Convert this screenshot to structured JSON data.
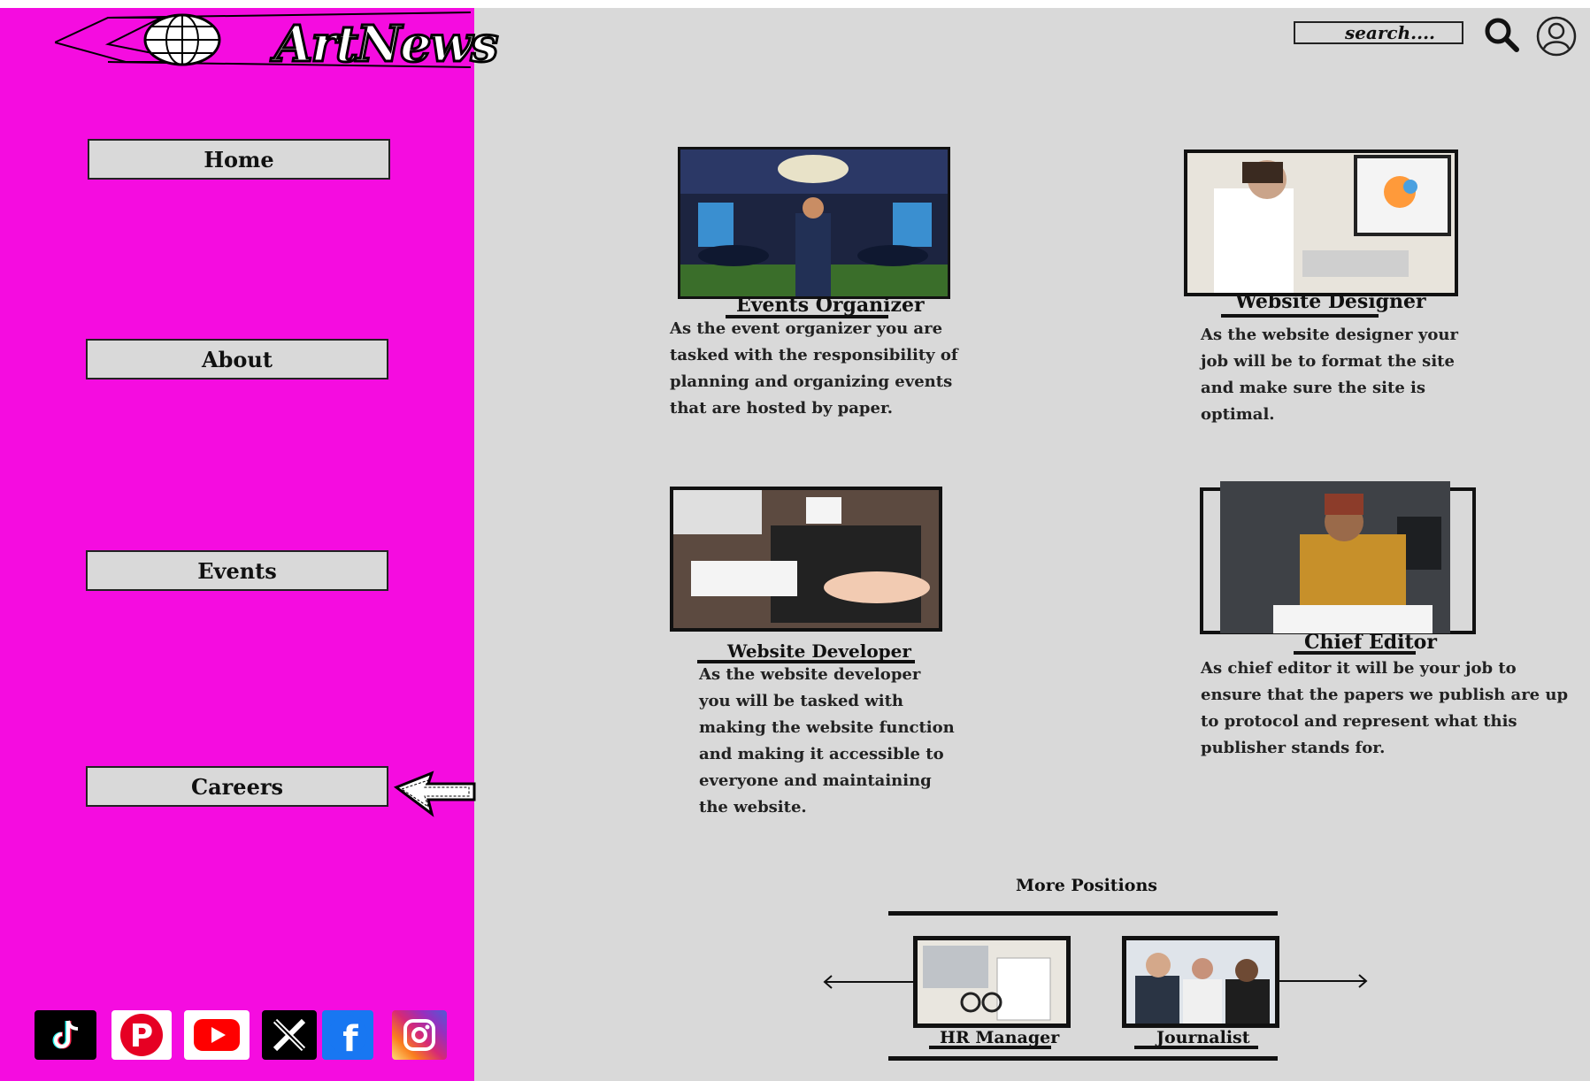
{
  "header": {
    "logo_text": "ArtNews",
    "search_placeholder": "search....",
    "search_icon": "magnifier",
    "user_icon": "user-circle"
  },
  "sidebar": {
    "color": "#f50ce0",
    "items": [
      {
        "label": "Home"
      },
      {
        "label": "About"
      },
      {
        "label": "Events"
      },
      {
        "label": "Careers"
      }
    ],
    "socials": [
      "tiktok",
      "pinterest",
      "youtube",
      "x",
      "facebook",
      "instagram"
    ]
  },
  "positions": [
    {
      "title": "Events Organizer",
      "description": "As the event organizer you are tasked with the responsibility of planning and organizing events that are hosted by paper."
    },
    {
      "title": "Website Designer",
      "description": "As the website designer your job will be to format the site and make sure the site is optimal."
    },
    {
      "title": "Website Developer",
      "description": "As the website developer you will be tasked with making the website function and making it accessible  to everyone and maintaining the website."
    },
    {
      "title": "Chief Editor",
      "description": "As chief editor it will be your job to ensure that the papers we publish are up to protocol and represent what this publisher stands for."
    }
  ],
  "more_positions": {
    "title": "More Positions",
    "items": [
      {
        "label": "HR Manager"
      },
      {
        "label": "Journalist"
      }
    ]
  }
}
